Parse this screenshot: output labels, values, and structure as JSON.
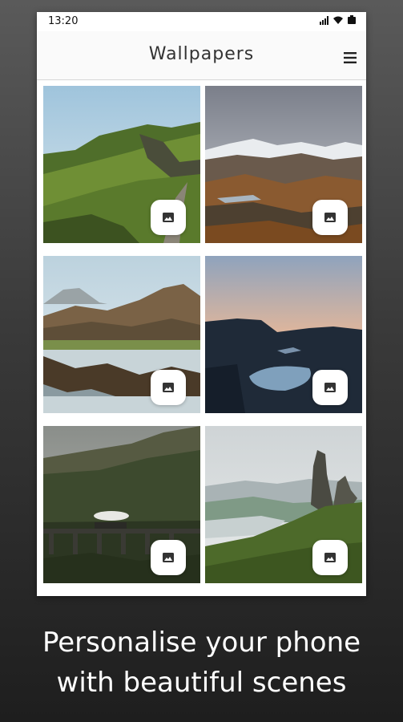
{
  "status_bar": {
    "time": "13:20"
  },
  "app_bar": {
    "title": "Wallpapers"
  },
  "wallpapers": [
    {
      "name": "Green mountain ridge with road"
    },
    {
      "name": "Snowy highland valley"
    },
    {
      "name": "Mountain lake reflection"
    },
    {
      "name": "Dusk lake in hills"
    },
    {
      "name": "Steam train on viaduct"
    },
    {
      "name": "Rock pinnacles above loch"
    }
  ],
  "caption": {
    "line1": "Personalise your phone",
    "line2": "with beautiful scenes"
  },
  "icons": {
    "menu": "hamburger-menu-icon",
    "wallpaper_button": "image-icon",
    "wifi": "wifi-icon",
    "signal": "signal-icon",
    "battery": "battery-icon"
  }
}
